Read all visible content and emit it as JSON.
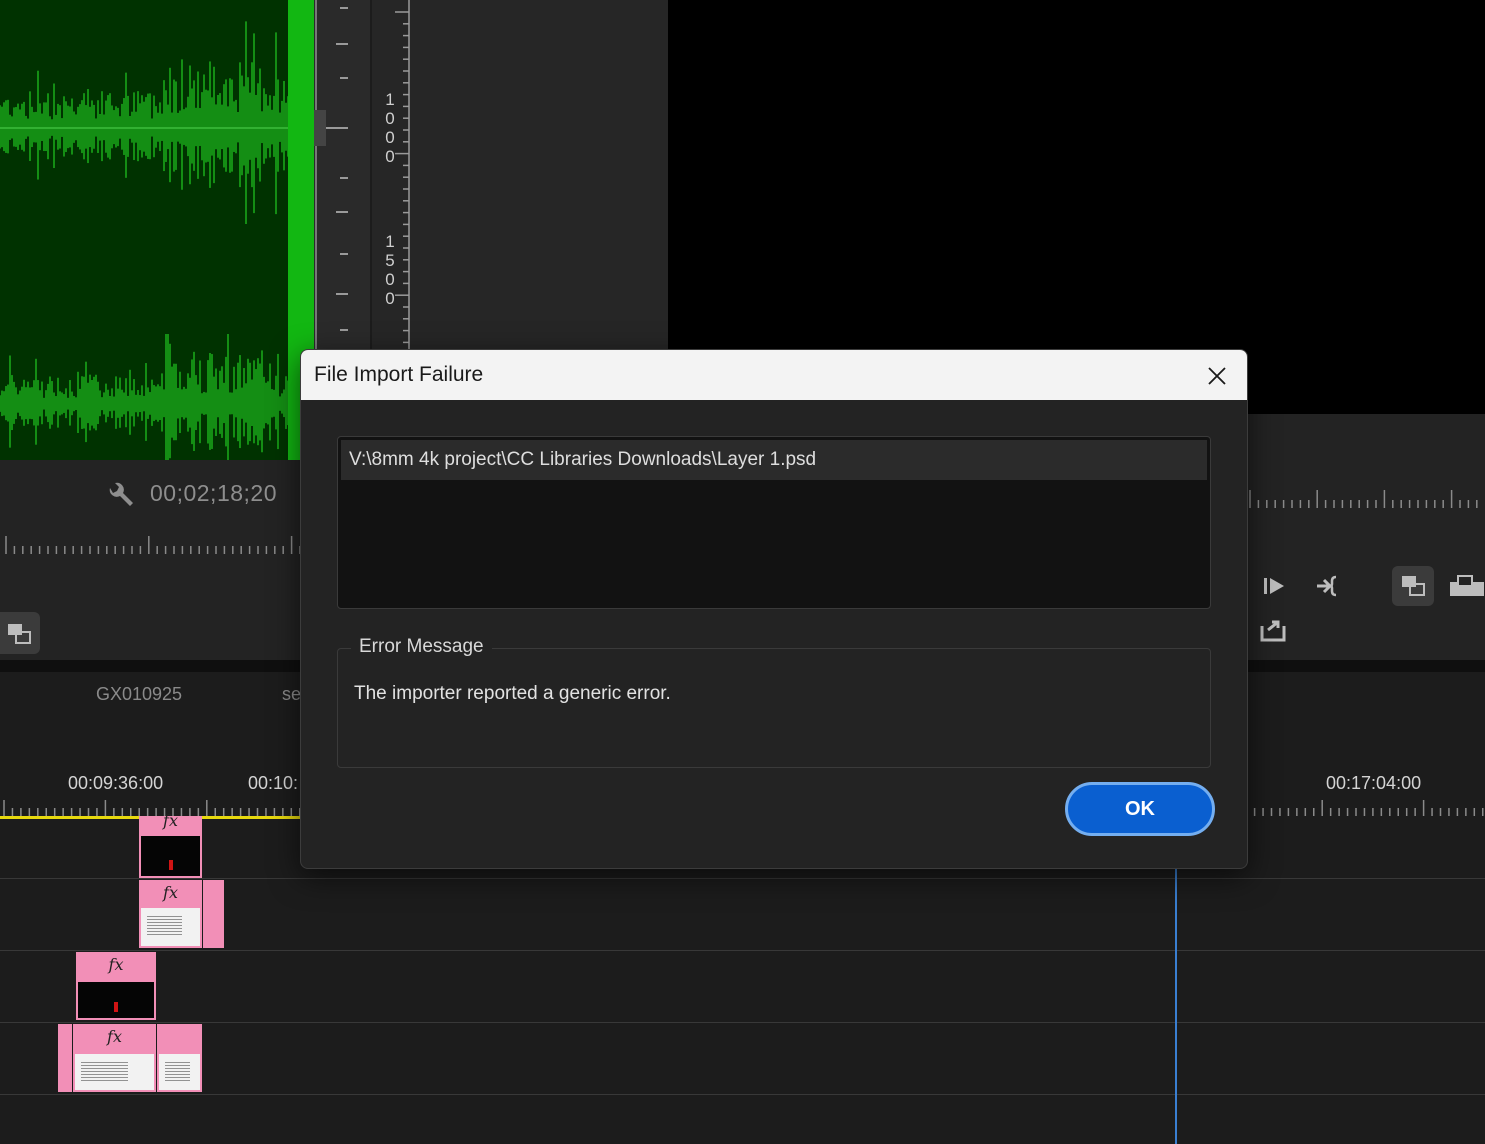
{
  "source_monitor": {
    "ruler_labels": [
      [
        "1",
        "0",
        "0",
        "0"
      ],
      [
        "1",
        "5",
        "0",
        "0"
      ]
    ],
    "timecode": "00;02;18;20"
  },
  "timeline": {
    "sequence_tab": "GX010925",
    "sequence_tab_2": "se",
    "timecode_labels": [
      "00:09:36:00",
      "00:10:",
      "00:17:04:00"
    ],
    "clip_label": "fx"
  },
  "dialog": {
    "title": "File Import Failure",
    "file_path": "V:\\8mm 4k project\\CC Libraries Downloads\\Layer 1.psd",
    "error_group_label": "Error Message",
    "error_text": "The importer reported a generic error.",
    "ok_label": "OK"
  },
  "colors": {
    "waveform": "#1fbf1f",
    "waveform_bg": "#003200",
    "clip": "#f28fb7",
    "playhead": "#3a7fd1",
    "work_area": "#e8d90e",
    "ok_button": "#0a5fd0"
  },
  "icons": [
    "wrench-icon",
    "close-icon",
    "step-forward-icon",
    "insert-icon",
    "export-frame-icon",
    "toggle-proxy-icon",
    "lift-icon"
  ]
}
